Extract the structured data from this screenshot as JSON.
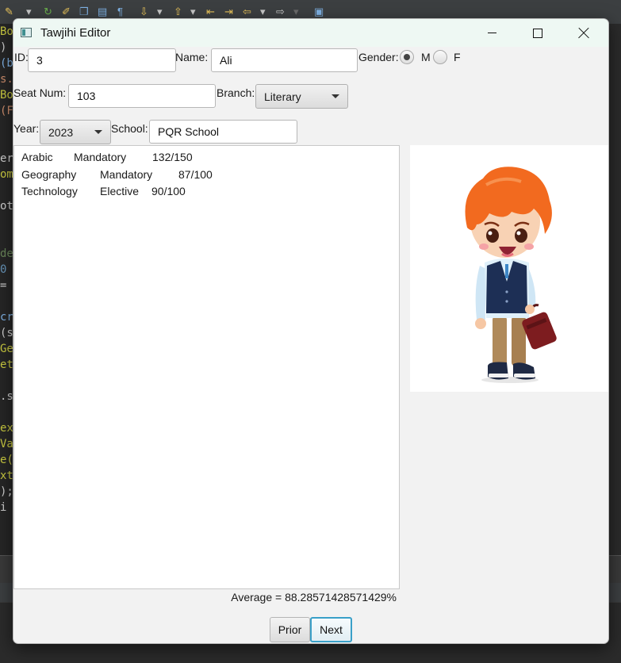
{
  "window": {
    "title": "Tawjihi Editor"
  },
  "form": {
    "id_label": "ID:",
    "id_value": "3",
    "name_label": "Name:",
    "name_value": "Ali",
    "gender_label": "Gender:",
    "gender_options": [
      {
        "label": "M",
        "selected": true
      },
      {
        "label": "F",
        "selected": false
      }
    ],
    "seat_label": "Seat Num:",
    "seat_value": "103",
    "branch_label": "Branch:",
    "branch_value": "Literary",
    "year_label": "Year:",
    "year_value": "2023",
    "school_label": "School:",
    "school_value": "PQR School"
  },
  "courses": [
    {
      "name": "Arabic",
      "type": "Mandatory",
      "mark": "132/150"
    },
    {
      "name": "Geography",
      "type": "Mandatory",
      "mark": "87/100"
    },
    {
      "name": "Technology",
      "type": "Elective",
      "mark": "90/100"
    }
  ],
  "average_text": "Average = 88.28571428571429%",
  "buttons": {
    "prior": "Prior",
    "next": "Next"
  },
  "image": {
    "icon": "student-cartoon-boy-with-briefcase"
  },
  "colors": {
    "focus": "#3aa0c8",
    "titlebar": "#eef8f3",
    "hair": "#f26a1f",
    "vest": "#1d2f55"
  }
}
